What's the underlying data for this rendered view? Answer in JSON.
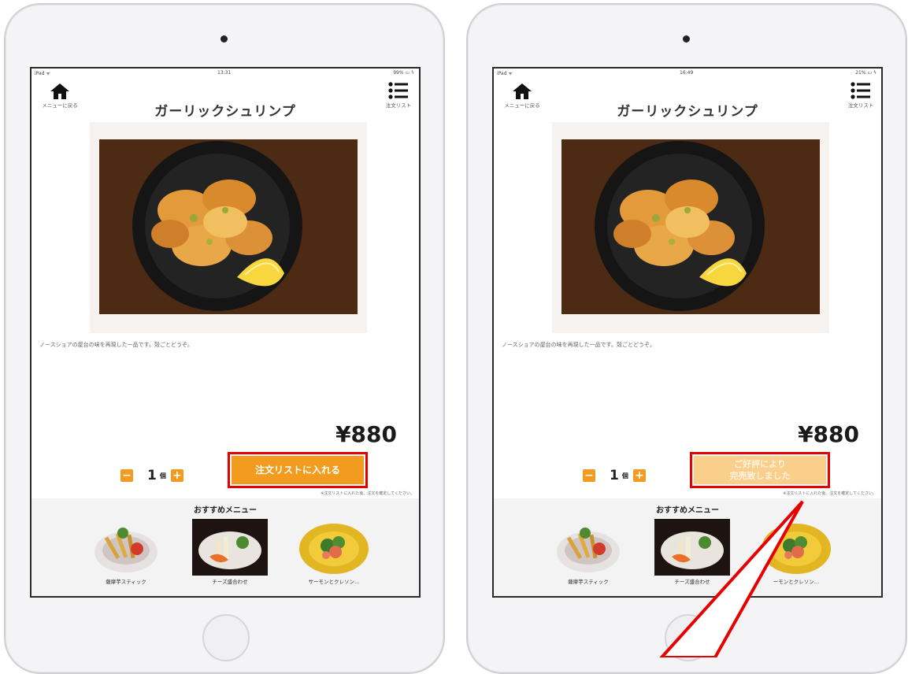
{
  "panels": [
    {
      "status": {
        "carrier": "iPad ᯤ",
        "time": "13:31",
        "battery": "99% ▭ ϟ"
      },
      "nav": {
        "home_label": "メニューに戻る",
        "list_label": "注文リスト"
      },
      "title": "ガーリックシュリンプ",
      "description": "ノースショアの屋台の味を再現した一品です。殻ごとどうぞ。",
      "price": "¥880",
      "quantity": {
        "minus": "−",
        "value": "1",
        "unit": "個",
        "plus": "+"
      },
      "cta_label": "注文リストに入れる",
      "note": "※注文リストに入れた後、注文を確定してください。",
      "recommend_title": "おすすめメニュー",
      "recommend_items": [
        {
          "label": "薩摩芋スティック"
        },
        {
          "label": "チーズ盛合わせ"
        },
        {
          "label": "サーモンとクレソン…"
        }
      ]
    },
    {
      "status": {
        "carrier": "iPad ᯤ",
        "time": "16:49",
        "battery": "21% ▭ ϟ"
      },
      "nav": {
        "home_label": "メニューに戻る",
        "list_label": "注文リスト"
      },
      "title": "ガーリックシュリンプ",
      "description": "ノースショアの屋台の味を再現した一品です。殻ごとどうぞ。",
      "price": "¥880",
      "quantity": {
        "minus": "−",
        "value": "1",
        "unit": "個",
        "plus": "+"
      },
      "cta_label_line1": "ご好評により",
      "cta_label_line2": "完売致しました",
      "note": "※注文リストに入れた後、注文を確定してください。",
      "recommend_title": "おすすめメニュー",
      "recommend_items": [
        {
          "label": "薩摩芋スティック"
        },
        {
          "label": "チーズ盛合わせ"
        },
        {
          "label": "ーモンとクレソン…"
        }
      ]
    }
  ],
  "colors": {
    "accent": "#f29b1f",
    "soldout": "#f9cf8b",
    "highlight": "#e60000"
  },
  "icons": [
    "home-icon",
    "list-icon"
  ]
}
